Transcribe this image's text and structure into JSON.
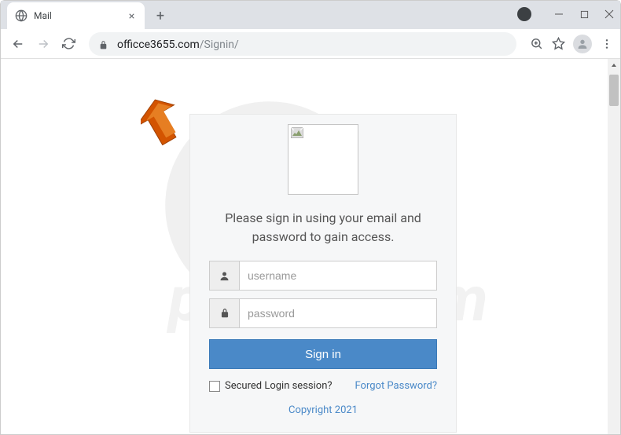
{
  "browser": {
    "tab_title": "Mail",
    "url_domain": "officce3655.com",
    "url_path": "/Signin/"
  },
  "login": {
    "heading": "Please sign in using your email and password to gain access.",
    "username_placeholder": "username",
    "password_placeholder": "password",
    "signin_button": "Sign in",
    "secured_label": "Secured Login session?",
    "forgot_label": "Forgot Password?",
    "copyright": "Copyright 2021"
  },
  "watermark": {
    "text": "pcrisk.com"
  }
}
